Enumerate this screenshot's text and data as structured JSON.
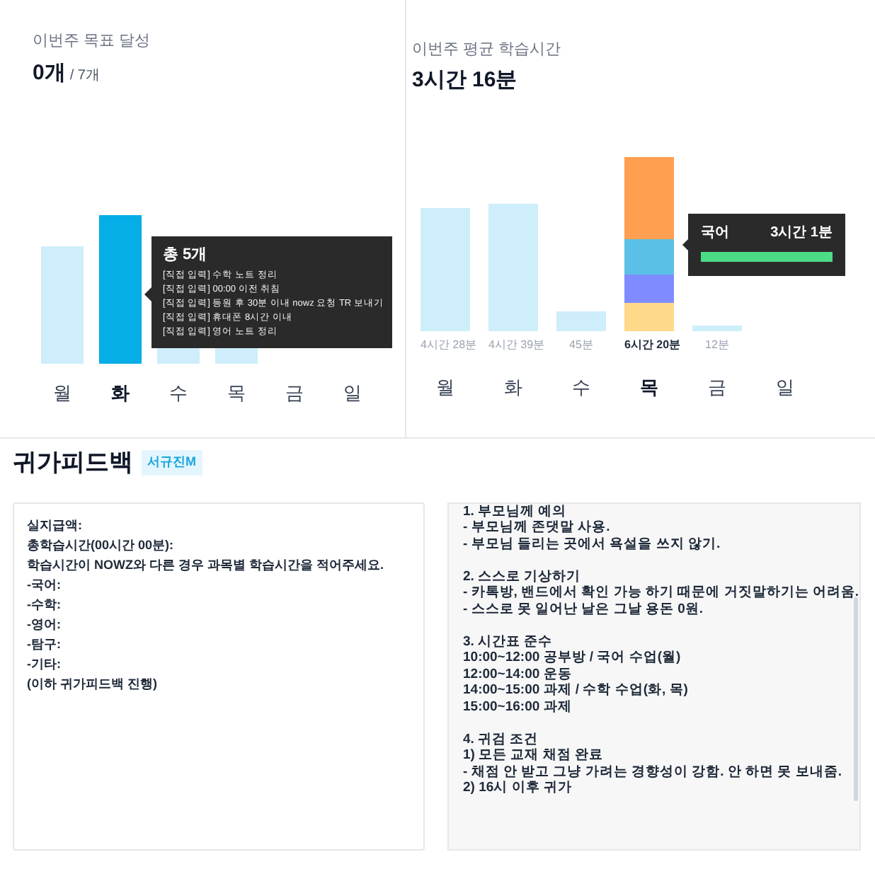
{
  "goal_card": {
    "label": "이번주 목표 달성",
    "value": "0개",
    "total": "/ 7개",
    "bars": [
      {
        "day": "월",
        "selected": false
      },
      {
        "day": "화",
        "selected": true
      },
      {
        "day": "수",
        "selected": false
      },
      {
        "day": "목",
        "selected": false
      },
      {
        "day": "금",
        "selected": false
      },
      {
        "day": "일",
        "selected": false
      }
    ],
    "tooltip": {
      "title": "총 5개",
      "items": [
        "[직접 입력] 수학 노트 정리",
        "[직접 입력] 00:00 이전 취침",
        "[직접 입력] 등원 후 30분 이내 nowz 요청 TR 보내기",
        "[직접 입력] 휴대폰 8시간 이내",
        "[직접 입력] 영어 노트 정리"
      ]
    }
  },
  "study_card": {
    "label": "이번주 평균 학습시간",
    "value": "3시간 16분",
    "bars": [
      {
        "day": "월",
        "reading": "4시간 28분",
        "selected": false
      },
      {
        "day": "화",
        "reading": "4시간 39분",
        "selected": false
      },
      {
        "day": "수",
        "reading": "45분",
        "selected": false
      },
      {
        "day": "목",
        "reading": "6시간 20분",
        "selected": true
      },
      {
        "day": "금",
        "reading": "12분",
        "selected": false
      },
      {
        "day": "일",
        "selected": false
      }
    ],
    "tooltip": {
      "subject": "국어",
      "time": "3시간 1분",
      "color": "#4ddc86",
      "level": 1
    }
  },
  "feedback": {
    "title": "귀가피드백",
    "badge": "서규진M",
    "left_field": {
      "lines": [
        "실지급액:",
        "총학습시간(00시간 00분):",
        "학습시간이 NOWZ와 다른 경우 과목별 학습시간을 적어주세요.",
        "-국어:",
        "-수학:",
        "-영어:",
        "-탐구:",
        "-기타:",
        "(이하 귀가피드백 진행)"
      ]
    },
    "right_field": {
      "paragraphs": [
        [
          "1. 부모님께 예의",
          "- 부모님께 존댓말 사용.",
          "- 부모님 들리는 곳에서 욕설을 쓰지 않기."
        ],
        [
          "2. 스스로 기상하기",
          "- 카톡방, 밴드에서 확인 가능 하기 때문에 거짓말하기는 어려움.",
          "- 스스로 못 일어난 날은 그날 용돈 0원."
        ],
        [
          "3. 시간표 준수",
          "10:00~12:00 공부방 / 국어 수업(월)",
          "12:00~14:00 운동",
          "14:00~15:00 과제 / 수학 수업(화, 목)",
          "15:00~16:00 과제"
        ],
        [
          "4. 귀검 조건",
          "1) 모든 교재 채점 완료",
          "- 채점 안 받고 그냥 가려는 경향성이 강함. 안 하면 못 보내줌.",
          "2) 16시 이후 귀가"
        ]
      ]
    }
  }
}
